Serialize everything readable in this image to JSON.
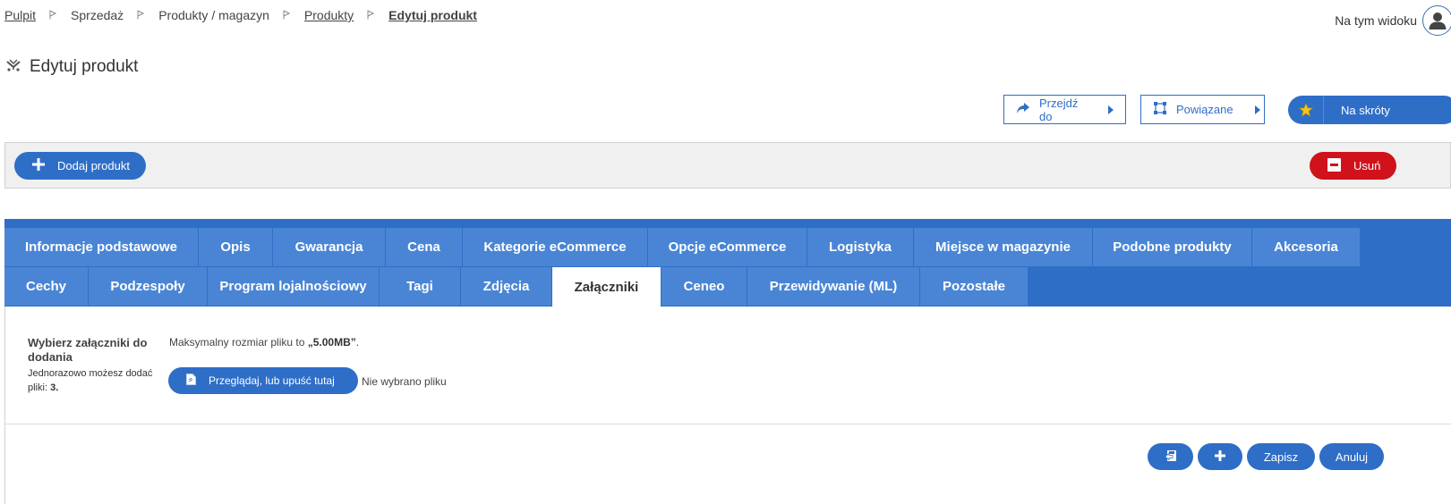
{
  "breadcrumb": {
    "items": [
      "Pulpit",
      "Sprzedaż",
      "Produkty / magazyn",
      "Produkty",
      "Edytuj produkt"
    ]
  },
  "header": {
    "view_label": "Na tym widoku",
    "title": "Edytuj produkt"
  },
  "toolbar": {
    "goto_label": "Przejdź do",
    "related_label": "Powiązane",
    "shortcuts_label": "Na skróty"
  },
  "actions": {
    "add_label": "Dodaj produkt",
    "delete_label": "Usuń"
  },
  "tabs": {
    "row1": [
      "Informacje podstawowe",
      "Opis",
      "Gwarancja",
      "Cena",
      "Kategorie eCommerce",
      "Opcje eCommerce",
      "Logistyka",
      "Miejsce w magazynie",
      "Podobne produkty",
      "Akcesoria"
    ],
    "row2": [
      "Cechy",
      "Podzespoły",
      "Program lojalnościowy",
      "Tagi",
      "Zdjęcia",
      "Załączniki",
      "Ceneo",
      "Przewidywanie (ML)",
      "Pozostałe"
    ],
    "active": "Załączniki"
  },
  "attachments": {
    "label": "Wybierz załączniki do dodania",
    "sub_prefix": "Jednorazowo możesz dodać pliki:",
    "max_count": "3.",
    "max_size_prefix": "Maksymalny rozmiar pliku to",
    "max_size_value": "„5.00MB”",
    "max_size_suffix": ".",
    "browse_label": "Przeglądaj, lub upuść tutaj",
    "no_file": "Nie wybrano pliku"
  },
  "footer": {
    "save_label": "Zapisz",
    "cancel_label": "Anuluj"
  },
  "colors": {
    "primary": "#2f6ec7",
    "tab": "#4a85d5",
    "danger": "#d0121b"
  }
}
